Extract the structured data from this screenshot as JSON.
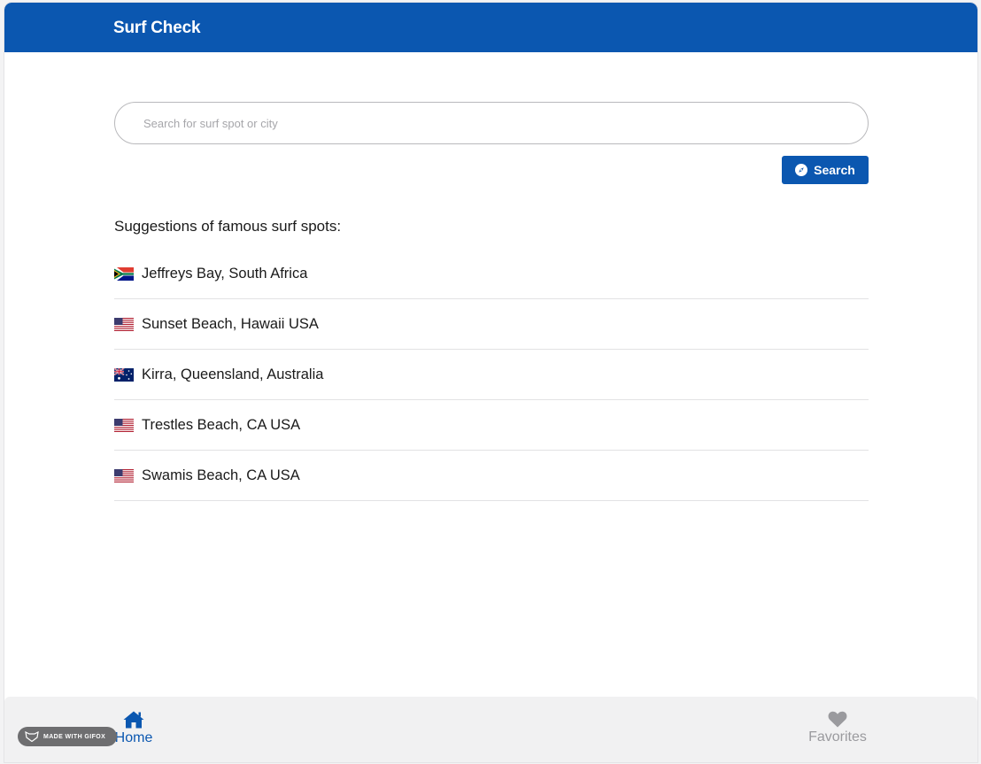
{
  "header": {
    "title": "Surf Check"
  },
  "search": {
    "placeholder": "Search for surf spot or city",
    "value": "",
    "button_label": "Search",
    "button_icon": "compass-icon"
  },
  "suggestions": {
    "heading": "Suggestions of famous surf spots:",
    "items": [
      {
        "label": "Jeffreys Bay, South Africa",
        "flag": "south-africa-flag-icon"
      },
      {
        "label": "Sunset Beach, Hawaii USA",
        "flag": "usa-flag-icon"
      },
      {
        "label": "Kirra, Queensland, Australia",
        "flag": "australia-flag-icon"
      },
      {
        "label": "Trestles Beach, CA USA",
        "flag": "usa-flag-icon"
      },
      {
        "label": "Swamis Beach, CA USA",
        "flag": "usa-flag-icon"
      }
    ]
  },
  "bottom_nav": {
    "items": [
      {
        "label": "Home",
        "icon": "home-icon",
        "active": true
      },
      {
        "label": "Favorites",
        "icon": "heart-icon",
        "active": false
      }
    ]
  },
  "watermark": {
    "text": "MADE WITH GIFOX"
  },
  "colors": {
    "primary": "#0b57b0",
    "inactive": "#9a9a9e",
    "footer_bg": "#f1f1f2"
  }
}
